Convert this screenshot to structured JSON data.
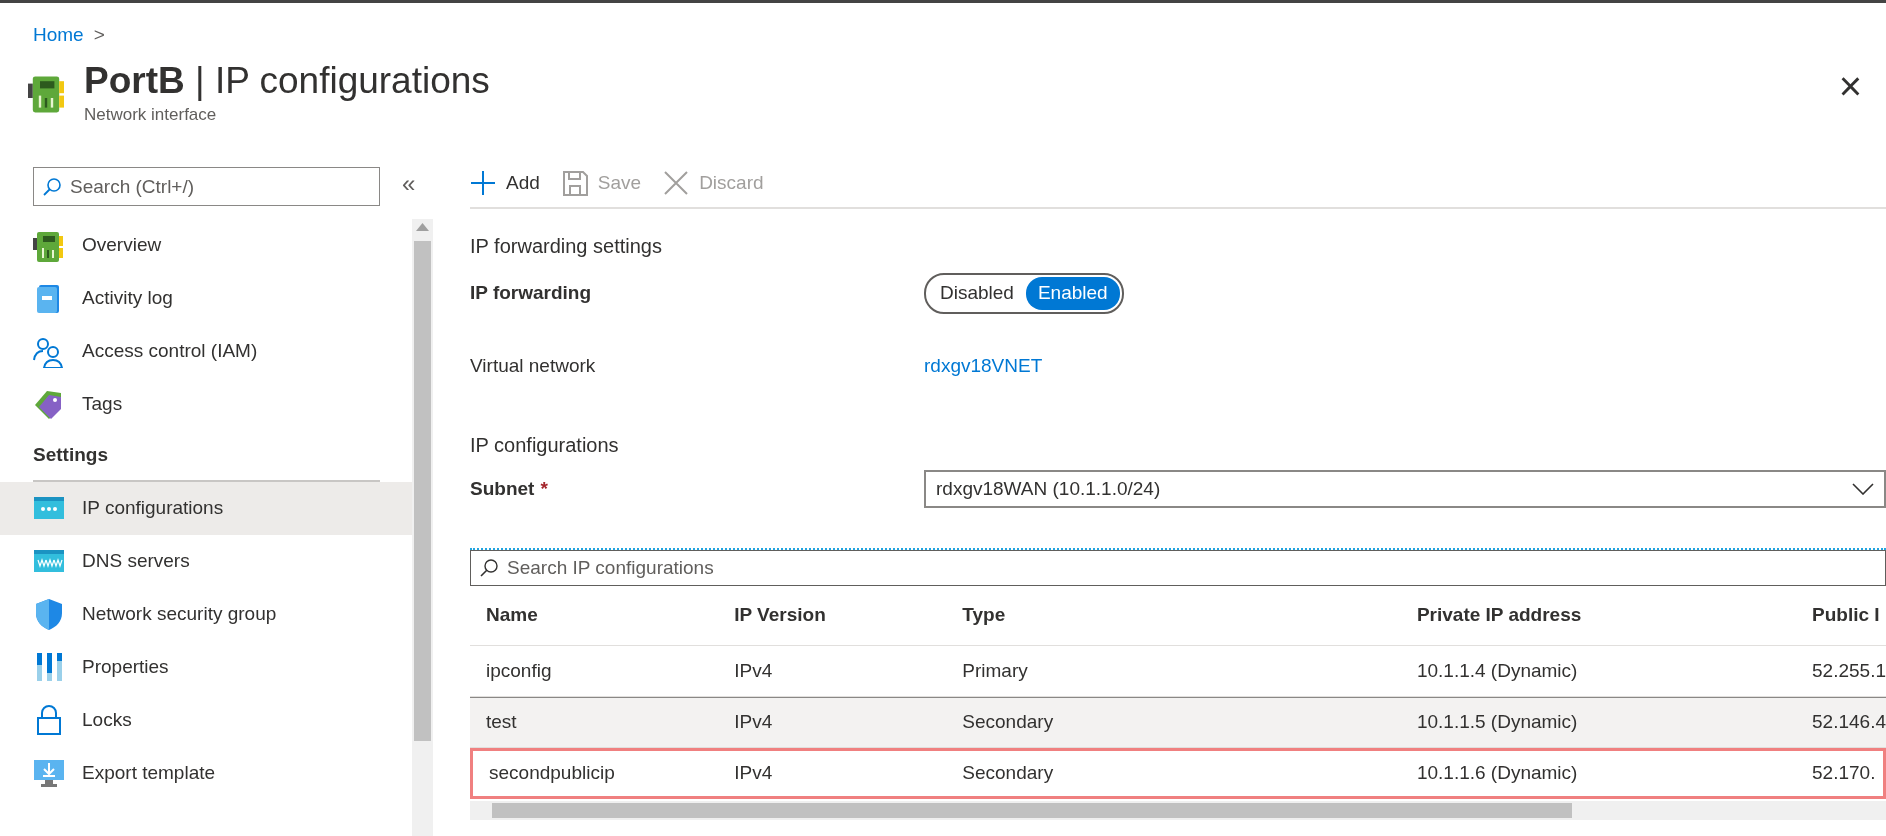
{
  "breadcrumb": {
    "items": [
      "Home"
    ],
    "separator": ">"
  },
  "header": {
    "resource": "PortB",
    "separator": "|",
    "title": "IP configurations",
    "subtitle": "Network interface",
    "close": "×"
  },
  "sidebar": {
    "search": {
      "placeholder": "Search (Ctrl+/)"
    },
    "collapse": "«",
    "groups": [
      {
        "items": [
          {
            "label": "Overview",
            "selected": false
          },
          {
            "label": "Activity log",
            "selected": false
          },
          {
            "label": "Access control (IAM)",
            "selected": false
          },
          {
            "label": "Tags",
            "selected": false
          }
        ]
      },
      {
        "heading": "Settings",
        "items": [
          {
            "label": "IP configurations",
            "selected": true
          },
          {
            "label": "DNS servers",
            "selected": false
          },
          {
            "label": "Network security group",
            "selected": false
          },
          {
            "label": "Properties",
            "selected": false
          },
          {
            "label": "Locks",
            "selected": false
          },
          {
            "label": "Export template",
            "selected": false
          }
        ]
      }
    ]
  },
  "toolbar": [
    {
      "kind": "add",
      "label": "Add",
      "disabled": false
    },
    {
      "kind": "save",
      "label": "Save",
      "disabled": true
    },
    {
      "kind": "discard",
      "label": "Discard",
      "disabled": true
    }
  ],
  "forwarding": {
    "heading": "IP forwarding settings",
    "label": "IP forwarding",
    "options": [
      {
        "label": "Disabled",
        "selected": false
      },
      {
        "label": "Enabled",
        "selected": true
      }
    ],
    "network_label": "Virtual network",
    "network_link": "rdxgv18VNET"
  },
  "ip_configurations": {
    "heading": "IP configurations",
    "subnet_label": "Subnet",
    "required": "*",
    "subnet_value": "rdxgv18WAN (10.1.1.0/24)",
    "search": {
      "placeholder": "Search IP configurations"
    },
    "table": {
      "columns": [
        "Name",
        "IP Version",
        "Type",
        "Private IP address",
        "Public I"
      ],
      "rows": [
        {
          "cells": [
            "ipconfig",
            "IPv4",
            "Primary",
            "10.1.1.4 (Dynamic)",
            "52.255.1"
          ],
          "selected": false,
          "highlighted": false
        },
        {
          "cells": [
            "test",
            "IPv4",
            "Secondary",
            "10.1.1.5 (Dynamic)",
            "52.146.4"
          ],
          "selected": true,
          "highlighted": false
        },
        {
          "cells": [
            "secondpublicip",
            "IPv4",
            "Secondary",
            "10.1.1.6 (Dynamic)",
            "52.170."
          ],
          "selected": false,
          "highlighted": true
        }
      ]
    }
  }
}
